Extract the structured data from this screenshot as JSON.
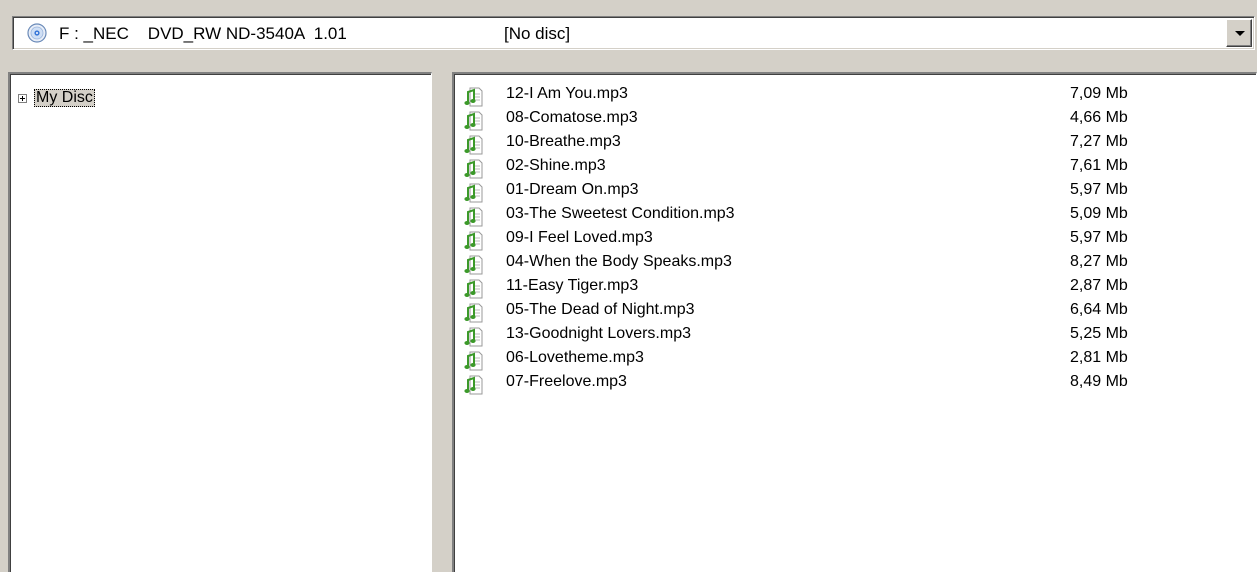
{
  "drive": {
    "icon": "cd-drive-icon",
    "label": "F : _NEC    DVD_RW ND-3540A  1.01",
    "status": "[No disc]"
  },
  "tree": {
    "root": {
      "label": "My Disc",
      "expander": "+"
    }
  },
  "files": [
    {
      "name": "12-I Am You.mp3",
      "size": "7,09 Mb"
    },
    {
      "name": "08-Comatose.mp3",
      "size": "4,66 Mb"
    },
    {
      "name": "10-Breathe.mp3",
      "size": "7,27 Mb"
    },
    {
      "name": "02-Shine.mp3",
      "size": "7,61 Mb"
    },
    {
      "name": "01-Dream On.mp3",
      "size": "5,97 Mb"
    },
    {
      "name": "03-The Sweetest Condition.mp3",
      "size": "5,09 Mb"
    },
    {
      "name": "09-I Feel Loved.mp3",
      "size": "5,97 Mb"
    },
    {
      "name": "04-When the Body Speaks.mp3",
      "size": "8,27 Mb"
    },
    {
      "name": "11-Easy Tiger.mp3",
      "size": "2,87 Mb"
    },
    {
      "name": "05-The Dead of Night.mp3",
      "size": "6,64 Mb"
    },
    {
      "name": "13-Goodnight Lovers.mp3",
      "size": "5,25 Mb"
    },
    {
      "name": "06-Lovetheme.mp3",
      "size": "2,81 Mb"
    },
    {
      "name": "07-Freelove.mp3",
      "size": "8,49 Mb"
    }
  ],
  "colors": {
    "window_bg": "#d4d0c8",
    "music_note": "#3c9a2a"
  }
}
